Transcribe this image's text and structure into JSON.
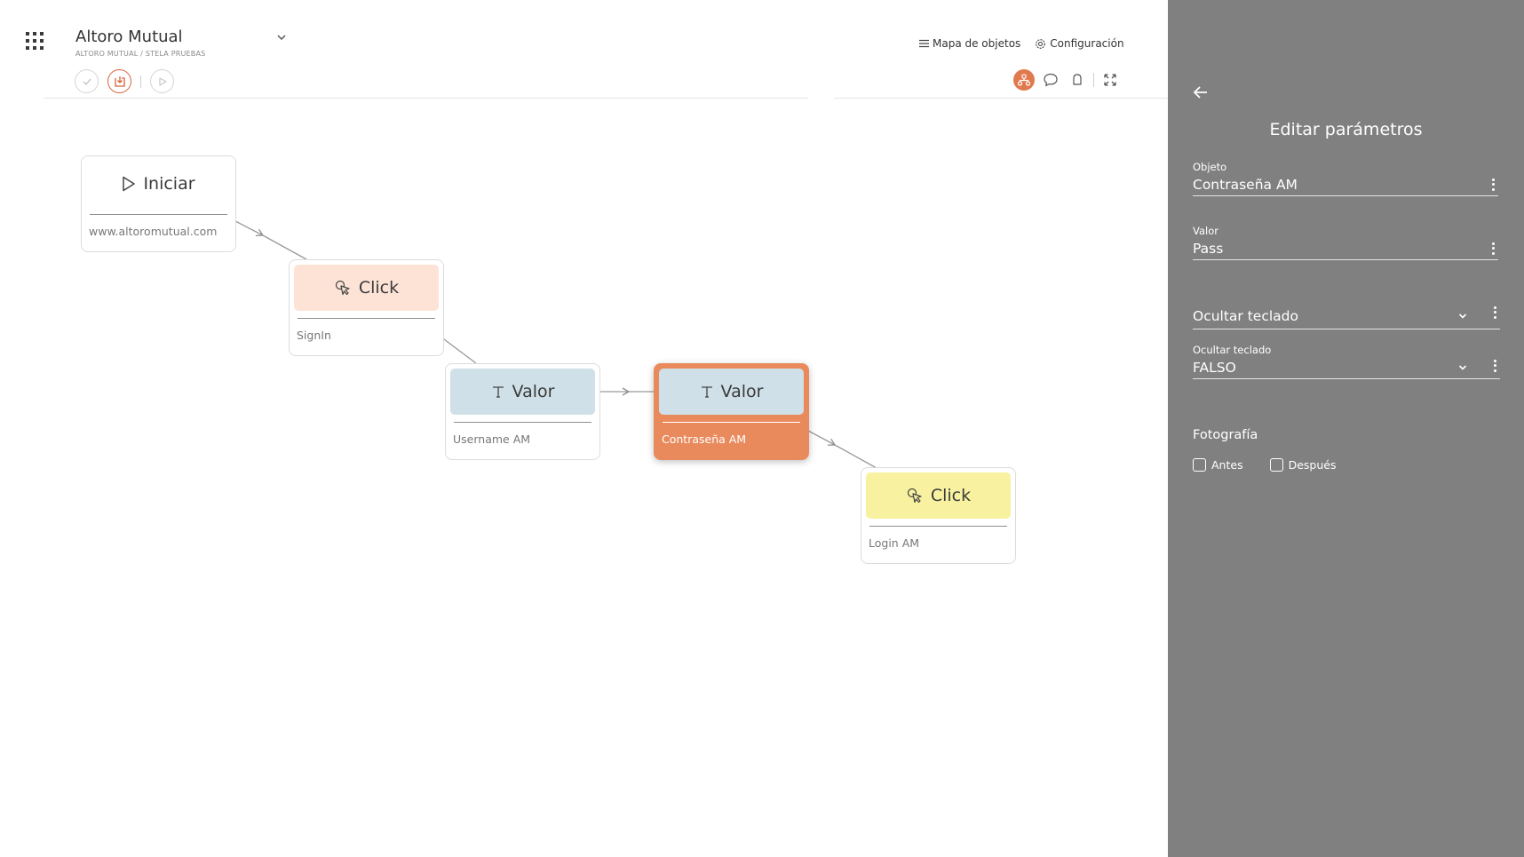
{
  "header": {
    "project_title": "Altoro Mutual",
    "breadcrumb": "ALTORO MUTUAL / STELA PRUEBAS",
    "links": {
      "object_map": "Mapa de objetos",
      "configuration": "Configuración"
    },
    "icons": {
      "apps": "grid-icon",
      "project_dropdown": "chevron-down-icon",
      "validate": "check-circle-icon",
      "save": "save-icon",
      "run": "play-icon",
      "object_map": "list-icon",
      "configuration": "gear-icon",
      "flow_view": "flow-icon",
      "comments": "comment-icon",
      "notifications": "bell-icon",
      "fullscreen": "expand-icon"
    }
  },
  "flow": {
    "nodes": [
      {
        "type": "Iniciar",
        "subtitle": "www.altoromutual.com",
        "icon": "play-icon",
        "color": "#ffffff"
      },
      {
        "type": "Click",
        "subtitle": "SignIn",
        "icon": "pointer-click-icon",
        "color": "#fce3d6"
      },
      {
        "type": "Valor",
        "subtitle": "Username AM",
        "icon": "text-icon",
        "color": "#cfe0e8"
      },
      {
        "type": "Valor",
        "subtitle": "Contraseña AM",
        "icon": "text-icon",
        "color": "#cfe0e8",
        "selected": true
      },
      {
        "type": "Click",
        "subtitle": "Login AM",
        "icon": "pointer-click-icon",
        "color": "#f8f2a0"
      }
    ]
  },
  "panel": {
    "title": "Editar parámetros",
    "fields": [
      {
        "label": "Objeto",
        "value": "Contraseña AM"
      },
      {
        "label": "Valor",
        "value": "Pass"
      },
      {
        "label": "",
        "value": "Ocultar teclado"
      },
      {
        "label": "Ocultar teclado",
        "value": "FALSO"
      }
    ],
    "photo": {
      "title": "Fotografía",
      "before": "Antes",
      "after": "Después",
      "before_checked": false,
      "after_checked": false
    }
  },
  "colors": {
    "accent": "#d9623b",
    "panel_bg": "#808080",
    "selected_node": "#e98a5d"
  }
}
